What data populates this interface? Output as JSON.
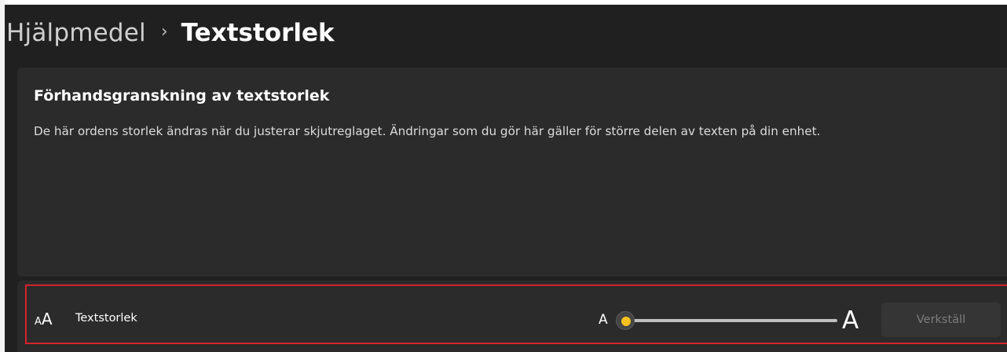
{
  "breadcrumb": {
    "parent": "Hjälpmedel",
    "separator": "›",
    "current": "Textstorlek"
  },
  "preview": {
    "title": "Förhandsgranskning av textstorlek",
    "description": "De här ordens storlek ändras när du justerar skjutreglaget. Ändringar som du gör här gäller för större delen av texten på din enhet."
  },
  "text_size_setting": {
    "icon": "text-size-icon",
    "label": "Textstorlek",
    "slider": {
      "min_label": "A",
      "max_label": "A",
      "value_fraction": 0.0,
      "accent_color": "#f9c21e"
    },
    "apply_label": "Verkställ",
    "apply_enabled": false,
    "highlight_color": "#d6232b"
  }
}
